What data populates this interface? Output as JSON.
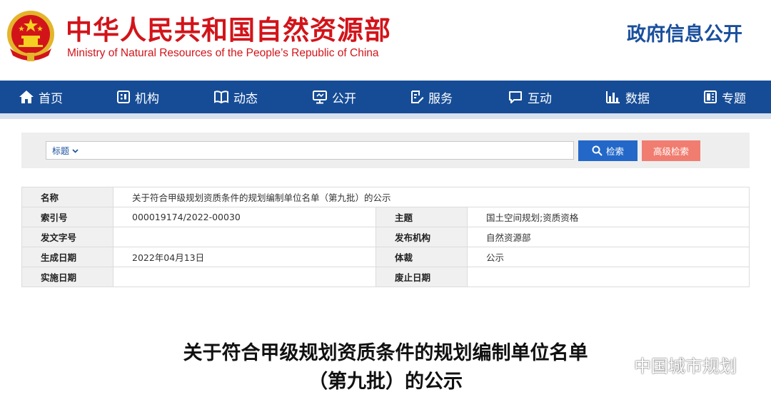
{
  "header": {
    "title_cn": "中华人民共和国自然资源部",
    "title_en": "Ministry of Natural Resources of the People’s Republic of China",
    "section": "政府信息公开"
  },
  "nav": {
    "items": [
      {
        "label": "首页",
        "icon": "home-icon"
      },
      {
        "label": "机构",
        "icon": "building-icon"
      },
      {
        "label": "动态",
        "icon": "book-icon"
      },
      {
        "label": "公开",
        "icon": "monitor-icon"
      },
      {
        "label": "服务",
        "icon": "document-edit-icon"
      },
      {
        "label": "互动",
        "icon": "chat-icon"
      },
      {
        "label": "数据",
        "icon": "bar-chart-icon"
      },
      {
        "label": "专题",
        "icon": "folder-icon"
      }
    ]
  },
  "search": {
    "type_label": "标题",
    "value": "",
    "search_button": "检索",
    "advanced_button": "高级检索"
  },
  "info": {
    "name_label": "名称",
    "name_value": "关于符合甲级规划资质条件的规划编制单位名单（第九批）的公示",
    "index_label": "索引号",
    "index_value": "000019174/2022-00030",
    "topic_label": "主题",
    "topic_value": "国土空间规划;资质资格",
    "doc_no_label": "发文字号",
    "doc_no_value": "",
    "issuer_label": "发布机构",
    "issuer_value": "自然资源部",
    "created_label": "生成日期",
    "created_value": "2022年04月13日",
    "genre_label": "体裁",
    "genre_value": "公示",
    "effective_label": "实施日期",
    "effective_value": "",
    "expiry_label": "废止日期",
    "expiry_value": ""
  },
  "article": {
    "title_line1": "关于符合甲级规划资质条件的规划编制单位名单",
    "title_line2": "（第九批）的公示"
  },
  "watermark": {
    "text": "中国城市规划"
  },
  "colors": {
    "brand_red": "#d2141a",
    "nav_blue": "#164c96",
    "search_blue": "#2368c8",
    "advanced_salmon": "#f07d6f"
  }
}
